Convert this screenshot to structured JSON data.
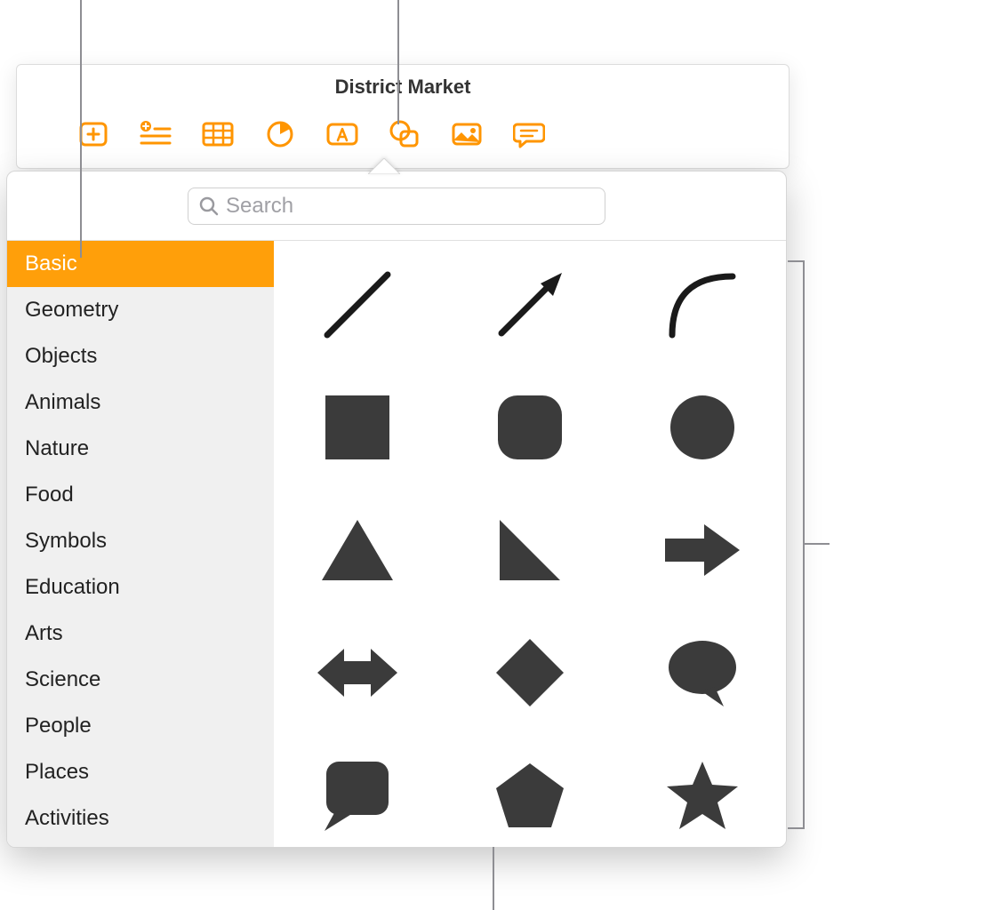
{
  "window": {
    "title": "District Market"
  },
  "toolbar": {
    "buttons": [
      {
        "name": "add-page-button",
        "icon": "add-page-icon"
      },
      {
        "name": "add-list-button",
        "icon": "add-list-icon"
      },
      {
        "name": "table-button",
        "icon": "table-icon"
      },
      {
        "name": "chart-button",
        "icon": "pie-chart-icon"
      },
      {
        "name": "text-box-button",
        "icon": "text-box-icon"
      },
      {
        "name": "shape-button",
        "icon": "shape-icon"
      },
      {
        "name": "media-button",
        "icon": "image-icon"
      },
      {
        "name": "comment-button",
        "icon": "comment-icon"
      }
    ]
  },
  "search": {
    "placeholder": "Search",
    "value": ""
  },
  "categories": [
    {
      "label": "Basic",
      "selected": true
    },
    {
      "label": "Geometry",
      "selected": false
    },
    {
      "label": "Objects",
      "selected": false
    },
    {
      "label": "Animals",
      "selected": false
    },
    {
      "label": "Nature",
      "selected": false
    },
    {
      "label": "Food",
      "selected": false
    },
    {
      "label": "Symbols",
      "selected": false
    },
    {
      "label": "Education",
      "selected": false
    },
    {
      "label": "Arts",
      "selected": false
    },
    {
      "label": "Science",
      "selected": false
    },
    {
      "label": "People",
      "selected": false
    },
    {
      "label": "Places",
      "selected": false
    },
    {
      "label": "Activities",
      "selected": false
    }
  ],
  "shapes": [
    {
      "id": "line",
      "name": "line-shape"
    },
    {
      "id": "arrow-line",
      "name": "arrow-line-shape"
    },
    {
      "id": "curve",
      "name": "curve-shape"
    },
    {
      "id": "square",
      "name": "square-shape"
    },
    {
      "id": "rounded-square",
      "name": "rounded-square-shape"
    },
    {
      "id": "circle",
      "name": "circle-shape"
    },
    {
      "id": "triangle",
      "name": "triangle-shape"
    },
    {
      "id": "right-triangle",
      "name": "right-triangle-shape"
    },
    {
      "id": "right-arrow",
      "name": "right-arrow-shape"
    },
    {
      "id": "double-arrow",
      "name": "double-arrow-shape"
    },
    {
      "id": "diamond",
      "name": "diamond-shape"
    },
    {
      "id": "speech-bubble",
      "name": "speech-bubble-shape"
    },
    {
      "id": "square-callout",
      "name": "square-callout-shape"
    },
    {
      "id": "pentagon",
      "name": "pentagon-shape"
    },
    {
      "id": "star",
      "name": "star-shape"
    }
  ],
  "colors": {
    "accent": "#FF9500",
    "shape": "#3b3b3b",
    "callout": "#8e8e93"
  }
}
